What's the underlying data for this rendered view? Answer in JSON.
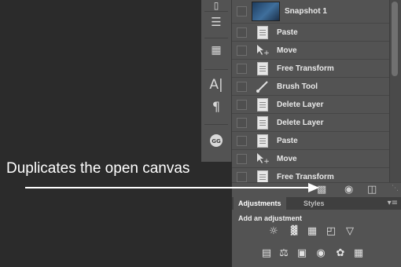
{
  "annotation": {
    "text": "Duplicates the open canvas"
  },
  "history": {
    "snapshot": {
      "label": "Snapshot 1"
    },
    "items": [
      {
        "label": "Paste",
        "icon": "document-icon"
      },
      {
        "label": "Move",
        "icon": "move-tool-icon"
      },
      {
        "label": "Free Transform",
        "icon": "document-icon"
      },
      {
        "label": "Brush Tool",
        "icon": "brush-icon"
      },
      {
        "label": "Delete Layer",
        "icon": "document-icon"
      },
      {
        "label": "Delete Layer",
        "icon": "document-icon"
      },
      {
        "label": "Paste",
        "icon": "document-icon"
      },
      {
        "label": "Move",
        "icon": "move-tool-icon"
      },
      {
        "label": "Free Transform",
        "icon": "document-icon"
      }
    ]
  },
  "bottom_bar": {
    "icons": [
      "new-document-from-state-icon",
      "create-snapshot-icon",
      "trash-icon"
    ]
  },
  "adjustments": {
    "tabs": [
      {
        "label": "Adjustments",
        "active": true
      },
      {
        "label": "Styles",
        "active": false
      }
    ],
    "title": "Add an adjustment",
    "row1_icons": [
      "brightness-icon",
      "levels-icon",
      "curves-icon",
      "exposure-icon",
      "vibrance-icon"
    ],
    "row2_icons": [
      "hue-saturation-icon",
      "color-balance-icon",
      "black-white-icon",
      "photo-filter-icon",
      "channel-mixer-icon",
      "color-lookup-icon"
    ]
  },
  "colors": {
    "panel": "#535353",
    "background": "#2b2b2b",
    "text": "#e9e9e9"
  }
}
